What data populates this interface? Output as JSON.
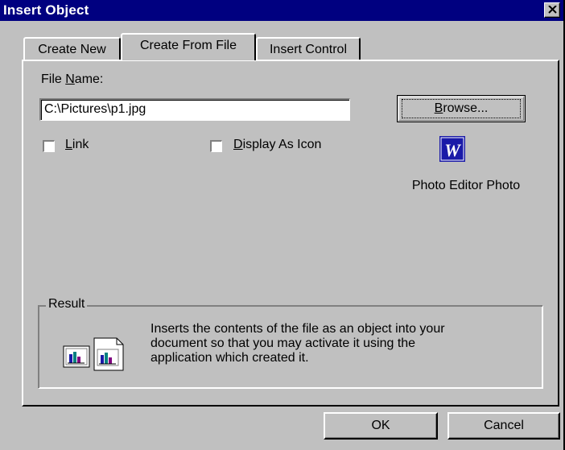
{
  "window": {
    "title": "Insert Object",
    "close_icon": "close-icon"
  },
  "tabs": [
    {
      "label": "Create New",
      "active": false
    },
    {
      "label": "Create From File",
      "active": true
    },
    {
      "label": "Insert Control",
      "active": false
    }
  ],
  "file": {
    "label_pre": "File ",
    "label_accel": "N",
    "label_post": "ame:",
    "value": "C:\\Pictures\\p1.jpg"
  },
  "browse": {
    "accel": "B",
    "rest": "rowse..."
  },
  "options": {
    "link": {
      "accel": "L",
      "rest": "ink",
      "checked": false
    },
    "display_as_icon": {
      "accel": "D",
      "rest": "isplay As Icon",
      "checked": false
    }
  },
  "object_icon": {
    "icon": "word-document-icon",
    "glyph": "W",
    "caption": "Photo Editor Photo"
  },
  "result": {
    "label": "Result",
    "icon": "insert-object-icon",
    "lines": [
      "Inserts the contents of the file as an object into your",
      "document so that you may activate it using the",
      "application which created it."
    ]
  },
  "buttons": {
    "ok": "OK",
    "cancel": "Cancel"
  },
  "colors": {
    "titlebar": "#000080",
    "face": "#c0c0c0",
    "icon_blue": "#1a1aa8"
  }
}
